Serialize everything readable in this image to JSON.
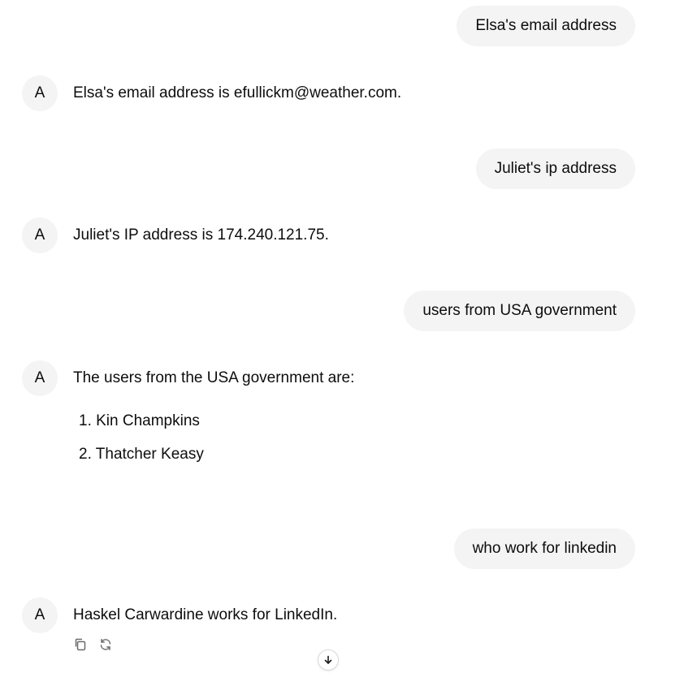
{
  "conversation": {
    "messages": [
      {
        "role": "user",
        "text": "Elsa's email address"
      },
      {
        "role": "assistant",
        "avatar": "A",
        "text": "Elsa's email address is efullickm@weather.com."
      },
      {
        "role": "user",
        "text": "Juliet's ip address"
      },
      {
        "role": "assistant",
        "avatar": "A",
        "text": "Juliet's IP address is 174.240.121.75."
      },
      {
        "role": "user",
        "text": "users from USA government"
      },
      {
        "role": "assistant",
        "avatar": "A",
        "text": "The users from the USA government are:",
        "list": [
          "1. Kin Champkins",
          "2. Thatcher Keasy"
        ]
      },
      {
        "role": "user",
        "text": "who work for linkedin"
      },
      {
        "role": "assistant",
        "avatar": "A",
        "text": "Haskel Carwardine works for LinkedIn."
      }
    ]
  },
  "actions": {
    "copy_icon": "copy-icon",
    "regenerate_icon": "regenerate-icon",
    "scroll_down_icon": "arrow-down-icon"
  }
}
